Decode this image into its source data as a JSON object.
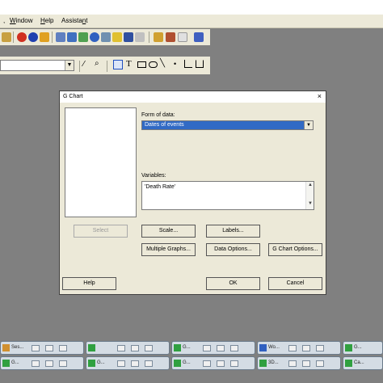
{
  "menubar": {
    "items": [
      "Window",
      "Help",
      "Assistant"
    ],
    "mnemonics": [
      "W",
      "H",
      "n"
    ]
  },
  "toolbar": {
    "icons": [
      "cut-icon",
      "stop-icon",
      "help-icon",
      "worksheet-icon",
      "copy-icon",
      "info-icon",
      "session-icon",
      "graph-icon",
      "grid-icon",
      "report-icon",
      "table-icon",
      "chart-icon",
      "window-icon"
    ],
    "graph_tools": [
      "brush-icon",
      "zoom-icon",
      "select-icon",
      "text-icon",
      "rectangle-icon",
      "ellipse-icon",
      "line-icon",
      "point-icon",
      "polyline-icon",
      "polygon-icon"
    ]
  },
  "dialog": {
    "title": "G Chart",
    "close_glyph": "×",
    "form_label": "Form of data:",
    "form_value": "Dates of events",
    "variables_label": "Variables:",
    "variables_value": "'Death Rate'",
    "buttons": {
      "select": "Select",
      "scale": "Scale...",
      "labels": "Labels...",
      "multiple_graphs": "Multiple Graphs...",
      "data_options": "Data Options...",
      "gchart_options": "G Chart Options...",
      "help": "Help",
      "ok": "OK",
      "cancel": "Cancel"
    }
  },
  "taskbar": {
    "tabs": [
      {
        "label": "Ses..."
      },
      {
        "label": ""
      },
      {
        "label": "G..."
      },
      {
        "label": "G..."
      },
      {
        "label": "Wo..."
      },
      {
        "label": "G..."
      },
      {
        "label": "G..."
      },
      {
        "label": "G..."
      },
      {
        "label": "G..."
      },
      {
        "label": "3D..."
      },
      {
        "label": "G..."
      },
      {
        "label": "Ca..."
      }
    ]
  },
  "colors": {
    "workspace": "#808080",
    "chrome": "#ece9d8",
    "selection": "#316ac5"
  }
}
